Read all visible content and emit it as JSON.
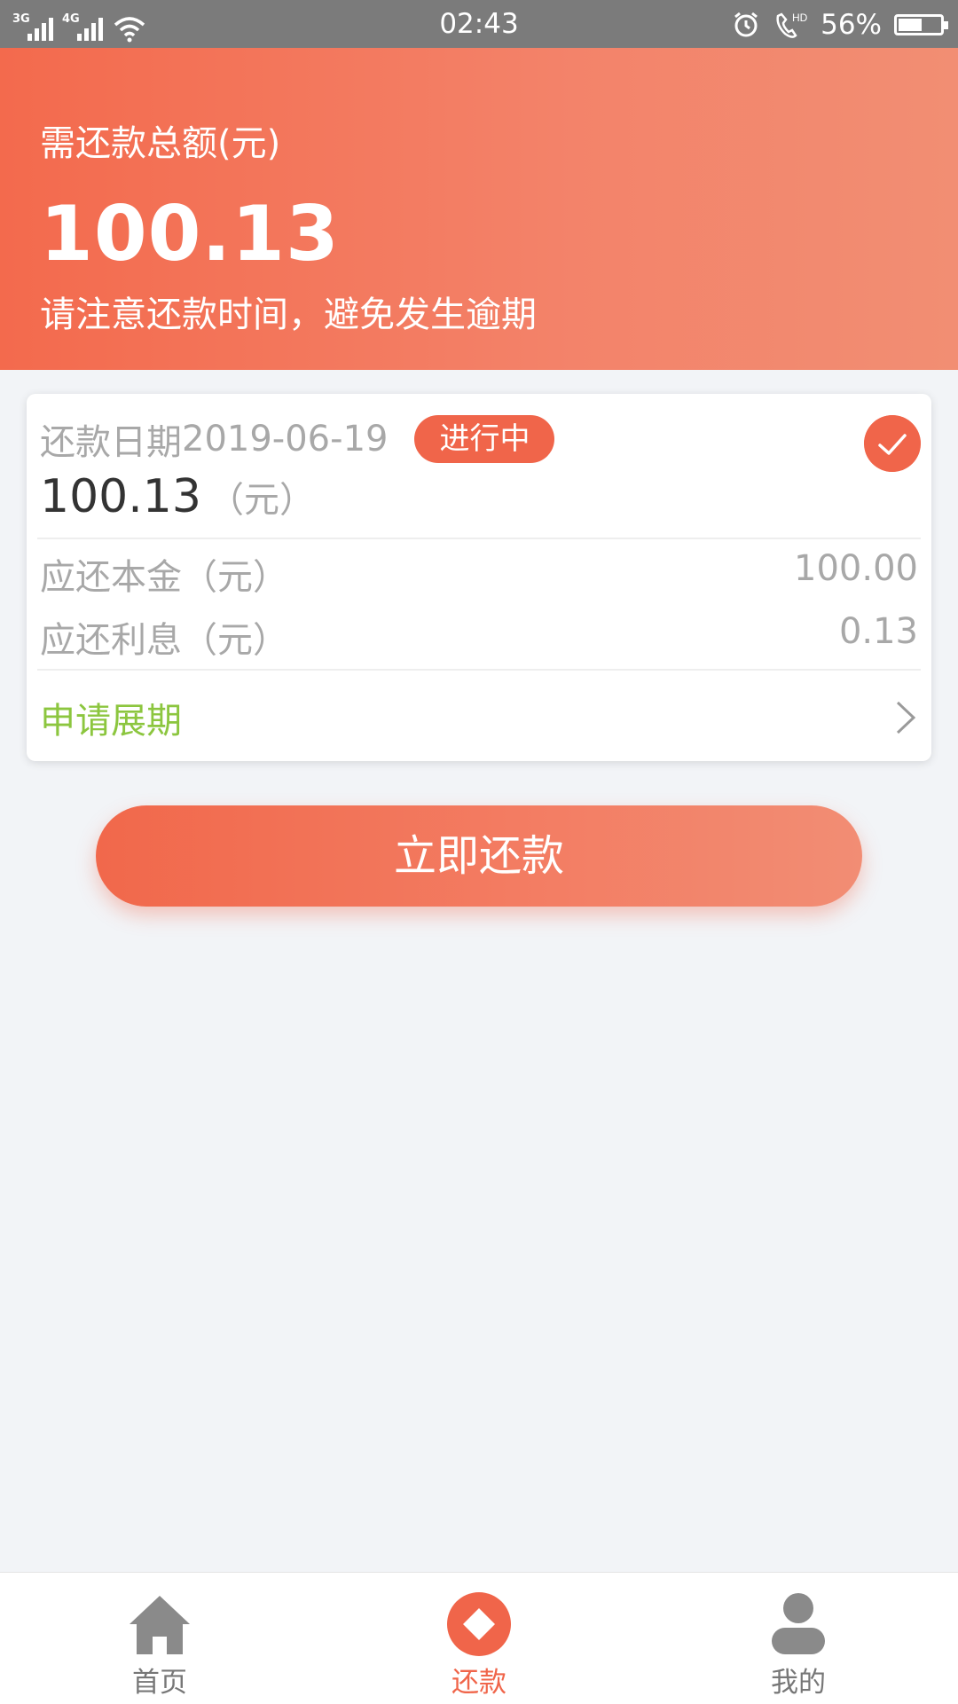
{
  "status_bar": {
    "network_1": "3G",
    "network_2": "4G",
    "time": "02:43",
    "battery_text": "56%",
    "battery_level": 0.56
  },
  "header": {
    "label": "需还款总额(元)",
    "amount": "100.13",
    "tip": "请注意还款时间，避免发生逾期"
  },
  "card": {
    "date_label": "还款日期",
    "date_value": "2019-06-19",
    "status": "进行中",
    "amount": "100.13",
    "amount_unit": "（元）",
    "principal_label": "应还本金（元）",
    "principal_value": "100.00",
    "interest_label": "应还利息（元）",
    "interest_value": "0.13",
    "extension_label": "申请展期"
  },
  "cta": {
    "label": "立即还款"
  },
  "bottom_nav": {
    "items": [
      {
        "label": "首页",
        "icon": "home-icon"
      },
      {
        "label": "还款",
        "icon": "repay-icon",
        "active": true
      },
      {
        "label": "我的",
        "icon": "user-icon"
      }
    ]
  },
  "colors": {
    "accent": "#f0654a",
    "green": "#8cc63f"
  }
}
